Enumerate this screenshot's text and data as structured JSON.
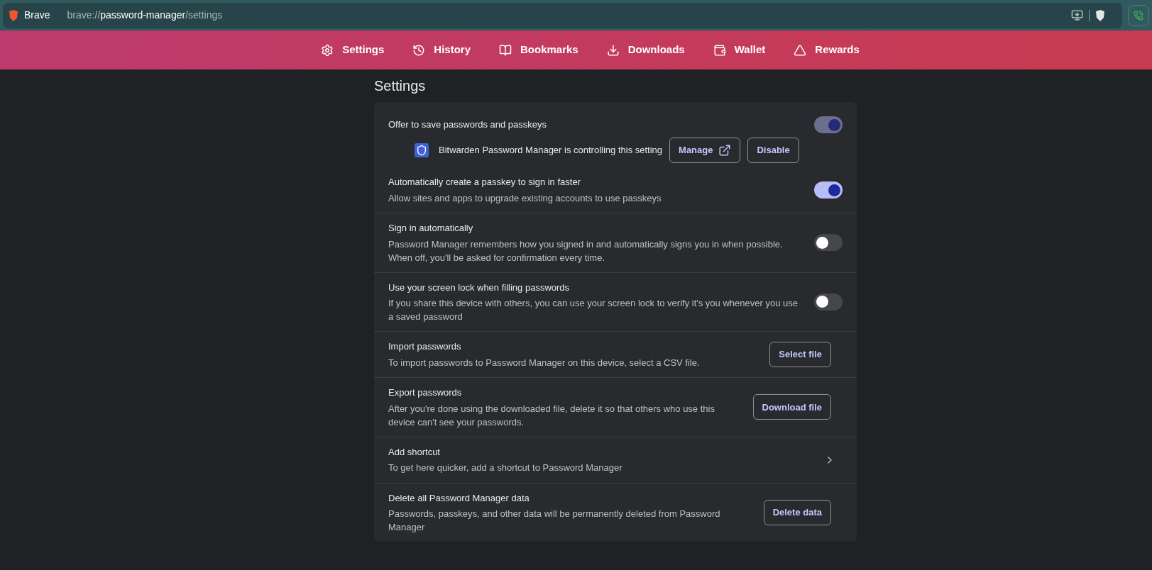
{
  "address_bar": {
    "brand": "Brave",
    "url_scheme": "brave://",
    "url_host": "password-manager",
    "url_path": "/settings"
  },
  "nav": [
    {
      "label": "Settings"
    },
    {
      "label": "History"
    },
    {
      "label": "Bookmarks"
    },
    {
      "label": "Downloads"
    },
    {
      "label": "Wallet"
    },
    {
      "label": "Rewards"
    }
  ],
  "page_title": "Settings",
  "sections": [
    {
      "items": [
        {
          "kind": "toggle",
          "title": "Offer to save passwords and passkeys",
          "on": true,
          "disabled": true,
          "extension": {
            "text": "Bitwarden Password Manager is controlling this setting",
            "buttons": [
              "Manage",
              "Disable"
            ]
          }
        },
        {
          "kind": "toggle",
          "title": "Automatically create a passkey to sign in faster",
          "description": "Allow sites and apps to upgrade existing accounts to use passkeys",
          "on": true,
          "disabled": false
        }
      ]
    },
    {
      "items": [
        {
          "kind": "toggle",
          "title": "Sign in automatically",
          "description": "Password Manager remembers how you signed in and automatically signs you in when possible. When off, you'll be asked for confirmation every time.",
          "on": false
        }
      ]
    },
    {
      "items": [
        {
          "kind": "toggle",
          "title": "Use your screen lock when filling passwords",
          "description": "If you share this device with others, you can use your screen lock to verify it's you whenever you use a saved password",
          "on": false
        }
      ]
    },
    {
      "items": [
        {
          "kind": "button",
          "title": "Import passwords",
          "description": "To import passwords to Password Manager on this device, select a CSV file.",
          "button": "Select file"
        }
      ]
    },
    {
      "items": [
        {
          "kind": "button",
          "title": "Export passwords",
          "description": "After you're done using the downloaded file, delete it so that others who use this device can't see your passwords.",
          "button": "Download file"
        }
      ]
    },
    {
      "items": [
        {
          "kind": "link",
          "title": "Add shortcut",
          "description": "To get here quicker, add a shortcut to Password Manager"
        }
      ]
    },
    {
      "items": [
        {
          "kind": "button",
          "title": "Delete all Password Manager data",
          "description": "Passwords, passkeys, and other data will be permanently deleted from Password Manager",
          "button": "Delete data"
        }
      ]
    }
  ]
}
